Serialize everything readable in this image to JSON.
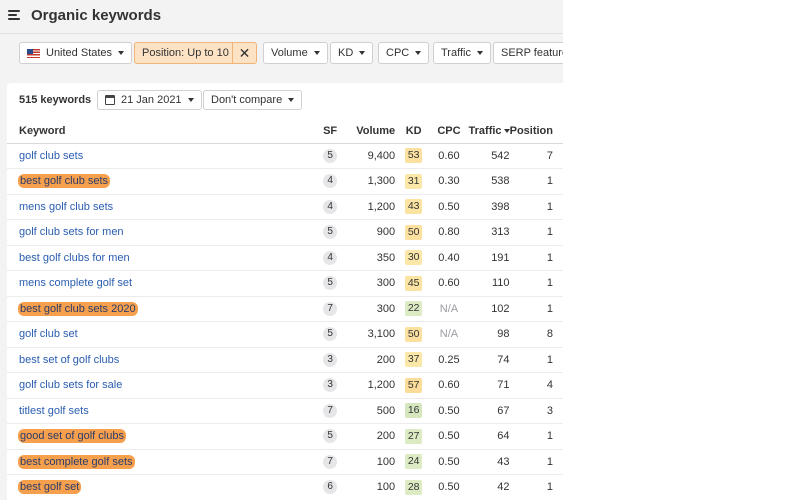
{
  "header": {
    "title": "Organic keywords"
  },
  "filters": {
    "country": "United States",
    "position": "Position: Up to 10",
    "position_clear": "✕",
    "volume": "Volume",
    "kd": "KD",
    "cpc": "CPC",
    "traffic": "Traffic",
    "serp": "SERP features"
  },
  "summary": {
    "count": "515 keywords",
    "date": "21 Jan 2021",
    "compare": "Don't compare"
  },
  "table": {
    "columns": {
      "keyword": "Keyword",
      "sf": "SF",
      "volume": "Volume",
      "kd": "KD",
      "cpc": "CPC",
      "traffic": "Traffic",
      "position": "Position"
    },
    "rows": [
      {
        "keyword": "golf club sets",
        "highlighted": false,
        "sf": "5",
        "volume": "9,400",
        "kd": "53",
        "kd_color": "#fbe0a0",
        "cpc": "0.60",
        "traffic": "542",
        "position": "7"
      },
      {
        "keyword": "best golf club sets",
        "highlighted": true,
        "sf": "4",
        "volume": "1,300",
        "kd": "31",
        "kd_color": "#fbe7a8",
        "cpc": "0.30",
        "traffic": "538",
        "position": "1"
      },
      {
        "keyword": "mens golf club sets",
        "highlighted": false,
        "sf": "4",
        "volume": "1,200",
        "kd": "43",
        "kd_color": "#fbe3a2",
        "cpc": "0.50",
        "traffic": "398",
        "position": "1"
      },
      {
        "keyword": "golf club sets for men",
        "highlighted": false,
        "sf": "5",
        "volume": "900",
        "kd": "50",
        "kd_color": "#fbe0a0",
        "cpc": "0.80",
        "traffic": "313",
        "position": "1"
      },
      {
        "keyword": "best golf clubs for men",
        "highlighted": false,
        "sf": "4",
        "volume": "350",
        "kd": "30",
        "kd_color": "#fbe7a8",
        "cpc": "0.40",
        "traffic": "191",
        "position": "1"
      },
      {
        "keyword": "mens complete golf set",
        "highlighted": false,
        "sf": "5",
        "volume": "300",
        "kd": "45",
        "kd_color": "#fbe3a2",
        "cpc": "0.60",
        "traffic": "110",
        "position": "1"
      },
      {
        "keyword": "best golf club sets 2020",
        "highlighted": true,
        "sf": "7",
        "volume": "300",
        "kd": "22",
        "kd_color": "#dcebc4",
        "cpc": "N/A",
        "traffic": "102",
        "position": "1"
      },
      {
        "keyword": "golf club set",
        "highlighted": false,
        "sf": "5",
        "volume": "3,100",
        "kd": "50",
        "kd_color": "#fbe0a0",
        "cpc": "N/A",
        "traffic": "98",
        "position": "8"
      },
      {
        "keyword": "best set of golf clubs",
        "highlighted": false,
        "sf": "3",
        "volume": "200",
        "kd": "37",
        "kd_color": "#fbe7a8",
        "cpc": "0.25",
        "traffic": "74",
        "position": "1"
      },
      {
        "keyword": "golf club sets for sale",
        "highlighted": false,
        "sf": "3",
        "volume": "1,200",
        "kd": "57",
        "kd_color": "#fbdc98",
        "cpc": "0.60",
        "traffic": "71",
        "position": "4"
      },
      {
        "keyword": "titlest golf sets",
        "highlighted": false,
        "sf": "7",
        "volume": "500",
        "kd": "16",
        "kd_color": "#d6e7c0",
        "cpc": "0.50",
        "traffic": "67",
        "position": "3"
      },
      {
        "keyword": "good set of golf clubs",
        "highlighted": true,
        "sf": "5",
        "volume": "200",
        "kd": "27",
        "kd_color": "#dcebc4",
        "cpc": "0.50",
        "traffic": "64",
        "position": "1"
      },
      {
        "keyword": "best complete golf sets",
        "highlighted": true,
        "sf": "7",
        "volume": "100",
        "kd": "24",
        "kd_color": "#dcebc4",
        "cpc": "0.50",
        "traffic": "43",
        "position": "1"
      },
      {
        "keyword": "best golf set",
        "highlighted": true,
        "sf": "6",
        "volume": "100",
        "kd": "28",
        "kd_color": "#dcebc4",
        "cpc": "0.50",
        "traffic": "42",
        "position": "1"
      }
    ]
  }
}
